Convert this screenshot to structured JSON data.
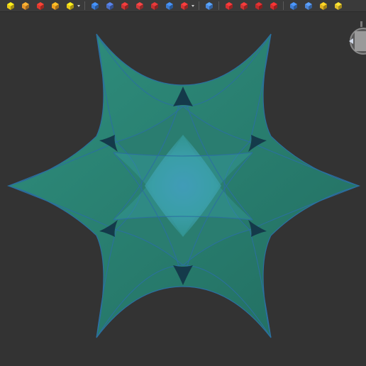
{
  "toolbar": {
    "groups": [
      [
        {
          "name": "box-yellow-icon",
          "color": "#e9c918"
        },
        {
          "name": "box-orange-icon",
          "color": "#e8962a"
        },
        {
          "name": "solid-red-yellow-icon",
          "color": "#e0382d"
        },
        {
          "name": "torus-orange-icon",
          "color": "#f0a020"
        },
        {
          "name": "part-dropdown-icon",
          "color": "#e9c918",
          "dropdown": true
        }
      ],
      [
        {
          "name": "extrude-blue-icon",
          "color": "#3a7bd5"
        },
        {
          "name": "revolve-blue-icon",
          "color": "#4a6fc6"
        },
        {
          "name": "mirror-red-icon",
          "color": "#cc3333"
        },
        {
          "name": "fillet-red-icon",
          "color": "#d13a3a"
        },
        {
          "name": "chamfer-red-icon",
          "color": "#c43030"
        },
        {
          "name": "rotate-blue-icon",
          "color": "#3b7bd0"
        },
        {
          "name": "boolean-dropdown-icon",
          "color": "#d23333",
          "dropdown": true
        }
      ],
      [
        {
          "name": "shape-builder-icon",
          "color": "#4a8ae0"
        }
      ],
      [
        {
          "name": "cut-red-icon",
          "color": "#d83030"
        },
        {
          "name": "union-red-icon",
          "color": "#cf3232"
        },
        {
          "name": "common-red-icon",
          "color": "#c02a2a"
        },
        {
          "name": "section-red-icon",
          "color": "#d42c2c"
        }
      ],
      [
        {
          "name": "measure-blue-icon",
          "color": "#3f7fd6"
        },
        {
          "name": "measure-linear-icon",
          "color": "#4c86d8"
        },
        {
          "name": "measure-angular-icon",
          "color": "#e0b21e"
        },
        {
          "name": "measure-clear-icon",
          "color": "#e3c02a"
        }
      ]
    ]
  },
  "viewport": {
    "background": "#333333",
    "model_colors": {
      "fill_dark": "#1f6a5e",
      "fill_mid": "#2e8c7f",
      "fill_light": "#3ea0a0",
      "center_highlight": "#4a90c8",
      "edge": "#2b6fa0"
    }
  }
}
